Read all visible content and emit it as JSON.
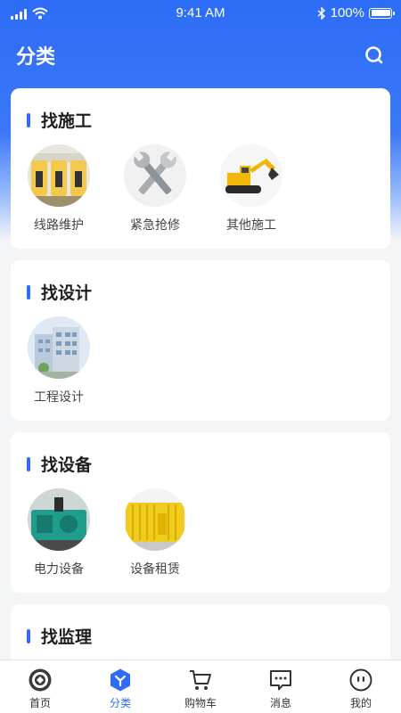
{
  "status_bar": {
    "time": "9:41 AM",
    "battery": "100%"
  },
  "header": {
    "title": "分类"
  },
  "sections": [
    {
      "title": "找施工",
      "items": [
        {
          "label": "线路维护",
          "image": "circuit-breakers"
        },
        {
          "label": "紧急抢修",
          "image": "wrenches"
        },
        {
          "label": "其他施工",
          "image": "excavator"
        }
      ]
    },
    {
      "title": "找设计",
      "items": [
        {
          "label": "工程设计",
          "image": "office-building"
        }
      ]
    },
    {
      "title": "找设备",
      "items": [
        {
          "label": "电力设备",
          "image": "generator"
        },
        {
          "label": "设备租赁",
          "image": "yellow-container"
        }
      ]
    },
    {
      "title": "找监理",
      "items": []
    }
  ],
  "tabbar": {
    "items": [
      {
        "label": "首页",
        "icon": "home-logo-icon",
        "active": false
      },
      {
        "label": "分类",
        "icon": "category-icon",
        "active": true
      },
      {
        "label": "购物车",
        "icon": "cart-icon",
        "active": false
      },
      {
        "label": "消息",
        "icon": "message-icon",
        "active": false
      },
      {
        "label": "我的",
        "icon": "profile-icon",
        "active": false
      }
    ]
  },
  "colors": {
    "accent": "#2d6cf6",
    "background": "#f4f5f7"
  }
}
